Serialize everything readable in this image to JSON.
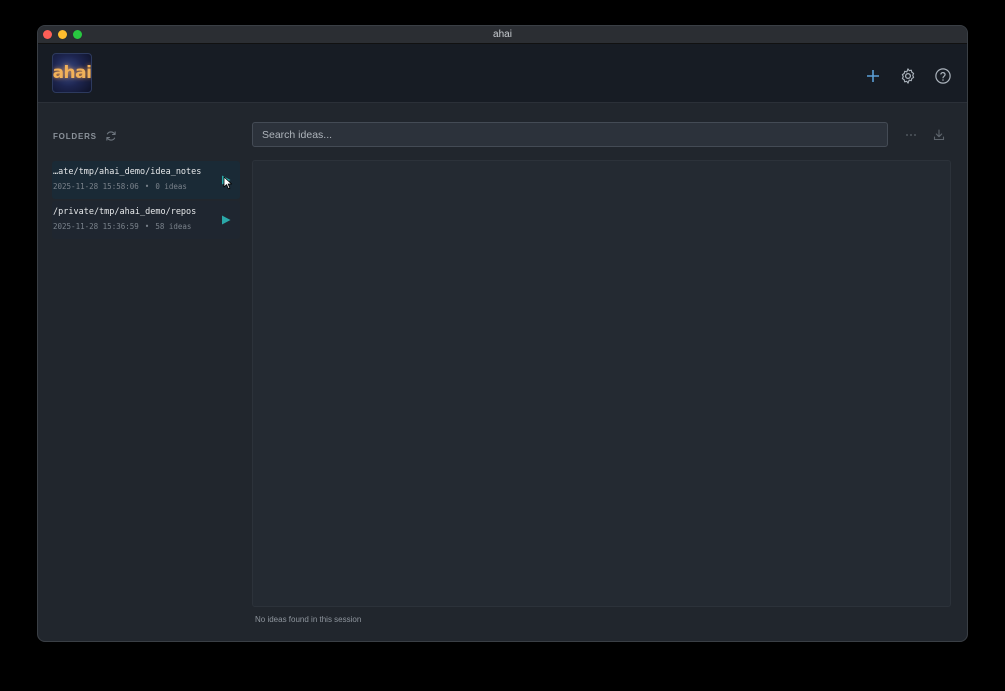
{
  "window": {
    "title": "ahai"
  },
  "header": {
    "logo_text": "ahai",
    "add_icon": "plus-icon",
    "settings_icon": "gear-icon",
    "help_icon": "question-circle-icon"
  },
  "sidebar": {
    "folders_label": "FOLDERS",
    "refresh_icon": "refresh-icon",
    "folders": [
      {
        "path": "…ate/tmp/ahai_demo/idea_notes",
        "timestamp": "2025-11-28 15:58:06",
        "ideas": "0 ideas",
        "active": true
      },
      {
        "path": "/private/tmp/ahai_demo/repos",
        "timestamp": "2025-11-28 15:36:59",
        "ideas": "58 ideas",
        "active": false
      }
    ]
  },
  "main": {
    "search_placeholder": "Search ideas...",
    "more_icon": "ellipsis-icon",
    "download_icon": "download-icon",
    "status_text": "No ideas found in this session"
  },
  "colors": {
    "accent": "#2aa8a8",
    "header_icon": "#5b9fd6",
    "background": "#21262d"
  }
}
